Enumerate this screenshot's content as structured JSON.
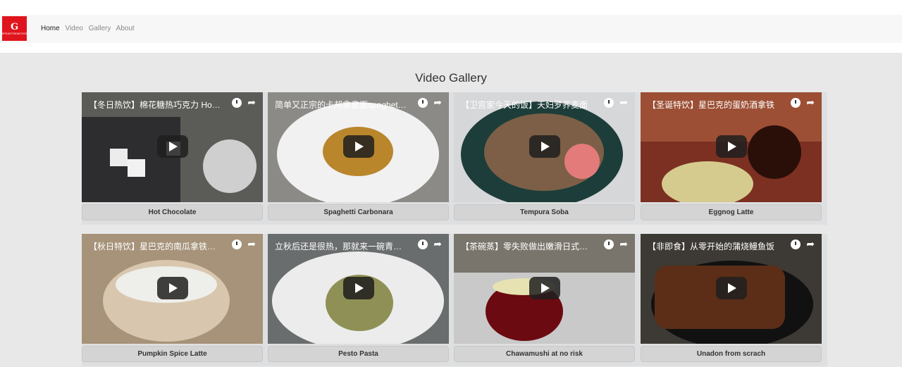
{
  "header": {
    "logo_mark": "G",
    "logo_tag": "SPEARTSEMCOSS",
    "nav": [
      "Home",
      "Video",
      "Gallery",
      "About"
    ]
  },
  "page": {
    "title": "Video Gallery"
  },
  "videos": [
    {
      "title": "【冬日热饮】棉花糖热巧克力 Hot Chocolate",
      "label": "Hot Chocolate"
    },
    {
      "title": "简单又正宗的卡邦拿意面spaghetti carbonara",
      "label": "Spaghetti Carbonara"
    },
    {
      "title": "【卫宫家今天的饭】天妇罗荞麦面",
      "label": "Tempura Soba"
    },
    {
      "title": "【圣诞特饮】星巴克的蛋奶酒拿铁",
      "label": "Eggnog Latte"
    },
    {
      "title": "【秋日特饮】星巴克的南瓜拿铁Pumpkin Spice Latte",
      "label": "Pumpkin Spice Latte"
    },
    {
      "title": "立秋后还是很热，那就来一碗青酱意面吧",
      "label": "Pesto Pasta"
    },
    {
      "title": "【茶碗蒸】零失败做出嫩滑日式茶碗蒸",
      "label": "Chawamushi at no risk"
    },
    {
      "title": "【非即食】从零开始的蒲烧鳗鱼饭",
      "label": "Unadon from scrach"
    }
  ],
  "colors": {
    "accent": "#e0141c",
    "nav_bg": "#f7f7f8",
    "main_bg": "#e8e8e9"
  }
}
